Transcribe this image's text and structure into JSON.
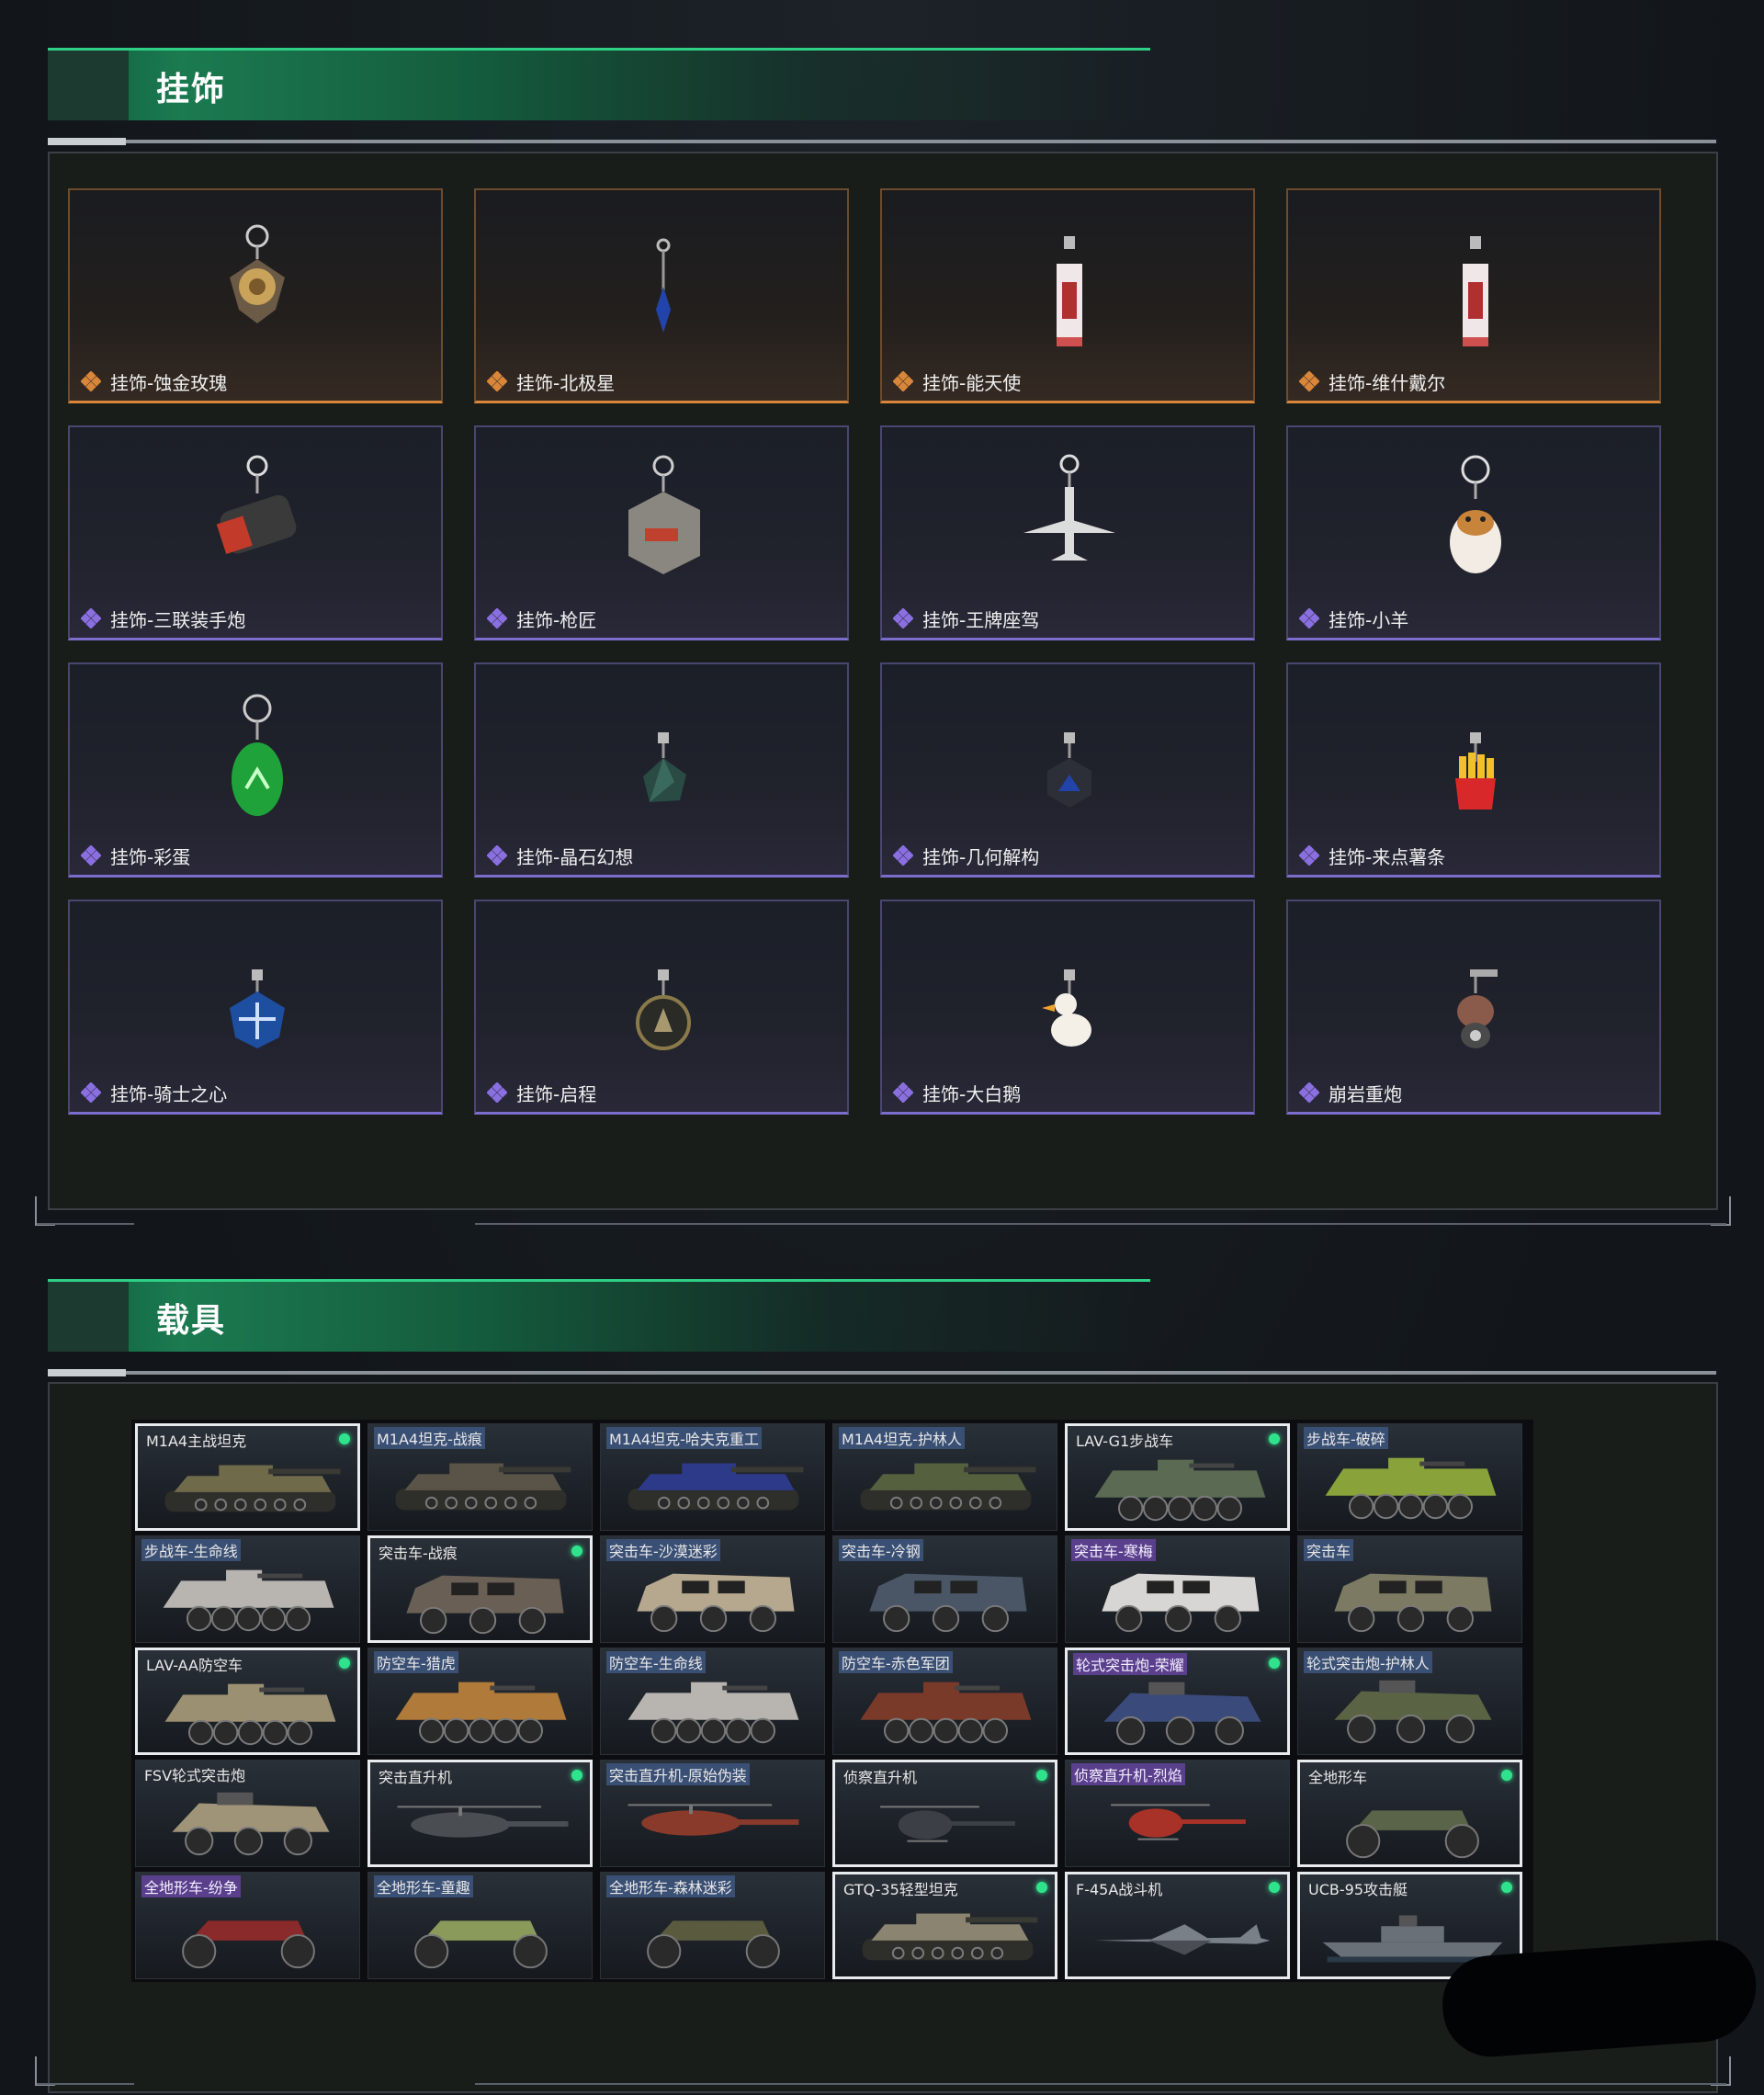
{
  "sections": {
    "charms": {
      "title": "挂饰",
      "items": [
        {
          "label": "挂饰-蚀金玫瑰",
          "rarity": "gold",
          "icon": "rose-charm-icon"
        },
        {
          "label": "挂饰-北极星",
          "rarity": "gold",
          "icon": "star-charm-icon"
        },
        {
          "label": "挂饰-能天使",
          "rarity": "gold",
          "icon": "tag-charm-icon"
        },
        {
          "label": "挂饰-维什戴尔",
          "rarity": "gold",
          "icon": "tag-charm-icon"
        },
        {
          "label": "挂饰-三联装手炮",
          "rarity": "purple",
          "icon": "cannon-charm-icon"
        },
        {
          "label": "挂饰-枪匠",
          "rarity": "purple",
          "icon": "box-charm-icon"
        },
        {
          "label": "挂饰-王牌座驾",
          "rarity": "purple",
          "icon": "plane-charm-icon"
        },
        {
          "label": "挂饰-小羊",
          "rarity": "purple",
          "icon": "sheep-charm-icon"
        },
        {
          "label": "挂饰-彩蛋",
          "rarity": "purple",
          "icon": "egg-charm-icon"
        },
        {
          "label": "挂饰-晶石幻想",
          "rarity": "purple",
          "icon": "crystal-charm-icon"
        },
        {
          "label": "挂饰-几何解构",
          "rarity": "purple",
          "icon": "geometry-charm-icon"
        },
        {
          "label": "挂饰-来点薯条",
          "rarity": "purple",
          "icon": "fries-charm-icon"
        },
        {
          "label": "挂饰-骑士之心",
          "rarity": "purple",
          "icon": "shield-charm-icon"
        },
        {
          "label": "挂饰-启程",
          "rarity": "purple",
          "icon": "medal-charm-icon"
        },
        {
          "label": "挂饰-大白鹅",
          "rarity": "purple",
          "icon": "goose-charm-icon"
        },
        {
          "label": "崩岩重炮",
          "rarity": "purple",
          "icon": "figure-charm-icon"
        }
      ]
    },
    "vehicles": {
      "title": "载具",
      "items": [
        {
          "label": "M1A4主战坦克",
          "selected": true,
          "badge": "none",
          "owned": true,
          "kind": "tank",
          "color": "#6f6a4a"
        },
        {
          "label": "M1A4坦克-战痕",
          "selected": false,
          "badge": "blu",
          "owned": false,
          "kind": "tank",
          "color": "#5a5448"
        },
        {
          "label": "M1A4坦克-哈夫克重工",
          "selected": false,
          "badge": "blu",
          "owned": false,
          "kind": "tank",
          "color": "#2d3a8a"
        },
        {
          "label": "M1A4坦克-护林人",
          "selected": false,
          "badge": "blu",
          "owned": false,
          "kind": "tank",
          "color": "#55603f"
        },
        {
          "label": "LAV-G1步战车",
          "selected": true,
          "badge": "none",
          "owned": true,
          "kind": "apc",
          "color": "#5b6a52"
        },
        {
          "label": "步战车-破碎",
          "selected": false,
          "badge": "blu",
          "owned": false,
          "kind": "apc",
          "color": "#8aa23a"
        },
        {
          "label": "步战车-生命线",
          "selected": false,
          "badge": "blu",
          "owned": false,
          "kind": "apc",
          "color": "#b8b4b0"
        },
        {
          "label": "突击车-战痕",
          "selected": true,
          "badge": "none",
          "owned": true,
          "kind": "truck",
          "color": "#6a5f55"
        },
        {
          "label": "突击车-沙漠迷彩",
          "selected": false,
          "badge": "blu",
          "owned": false,
          "kind": "truck",
          "color": "#b5a88e"
        },
        {
          "label": "突击车-冷钢",
          "selected": false,
          "badge": "blu",
          "owned": false,
          "kind": "truck",
          "color": "#4a5666"
        },
        {
          "label": "突击车-寒梅",
          "selected": false,
          "badge": "pur",
          "owned": false,
          "kind": "truck",
          "color": "#d8d6d4"
        },
        {
          "label": "突击车",
          "selected": false,
          "badge": "blu",
          "owned": false,
          "kind": "truck",
          "color": "#7c7a62"
        },
        {
          "label": "LAV-AA防空车",
          "selected": true,
          "badge": "none",
          "owned": true,
          "kind": "apc",
          "color": "#9c9072"
        },
        {
          "label": "防空车-猎虎",
          "selected": false,
          "badge": "blu",
          "owned": false,
          "kind": "apc",
          "color": "#b07a3a"
        },
        {
          "label": "防空车-生命线",
          "selected": false,
          "badge": "blu",
          "owned": false,
          "kind": "apc",
          "color": "#b8b4b0"
        },
        {
          "label": "防空车-赤色军团",
          "selected": false,
          "badge": "blu",
          "owned": false,
          "kind": "apc",
          "color": "#7a3a2a"
        },
        {
          "label": "轮式突击炮-荣耀",
          "selected": true,
          "badge": "pur",
          "owned": true,
          "kind": "buggy",
          "color": "#3a4a7a"
        },
        {
          "label": "轮式突击炮-护林人",
          "selected": false,
          "badge": "blu",
          "owned": false,
          "kind": "buggy",
          "color": "#5a6444"
        },
        {
          "label": "FSV轮式突击炮",
          "selected": false,
          "badge": "none",
          "owned": false,
          "kind": "buggy",
          "color": "#a09478"
        },
        {
          "label": "突击直升机",
          "selected": true,
          "badge": "none",
          "owned": true,
          "kind": "heli",
          "color": "#4a4e52"
        },
        {
          "label": "突击直升机-原始伪装",
          "selected": false,
          "badge": "blu",
          "owned": false,
          "kind": "heli",
          "color": "#8a3a2a"
        },
        {
          "label": "侦察直升机",
          "selected": true,
          "badge": "none",
          "owned": true,
          "kind": "lheli",
          "color": "#3c4046"
        },
        {
          "label": "侦察直升机-烈焰",
          "selected": false,
          "badge": "pur",
          "owned": false,
          "kind": "lheli",
          "color": "#a83228"
        },
        {
          "label": "全地形车",
          "selected": true,
          "badge": "none",
          "owned": true,
          "kind": "atv",
          "color": "#5a6448"
        },
        {
          "label": "全地形车-纷争",
          "selected": false,
          "badge": "pur",
          "owned": false,
          "kind": "atv",
          "color": "#8a2a2a"
        },
        {
          "label": "全地形车-童趣",
          "selected": false,
          "badge": "blu",
          "owned": false,
          "kind": "atv",
          "color": "#8a9a5a"
        },
        {
          "label": "全地形车-森林迷彩",
          "selected": false,
          "badge": "blu",
          "owned": false,
          "kind": "atv",
          "color": "#5a5a3e"
        },
        {
          "label": "GTQ-35轻型坦克",
          "selected": true,
          "badge": "none",
          "owned": true,
          "kind": "tank",
          "color": "#8a8470"
        },
        {
          "label": "F-45A战斗机",
          "selected": true,
          "badge": "none",
          "owned": true,
          "kind": "jet",
          "color": "#7a8088"
        },
        {
          "label": "UCB-95攻击艇",
          "selected": true,
          "badge": "none",
          "owned": true,
          "kind": "boat",
          "color": "#6a7078"
        }
      ]
    }
  },
  "colors": {
    "accent_green": "#2fcf86",
    "gold_rarity": "#d8863a",
    "purple_rarity": "#8a6fe0",
    "owned_dot": "#2fe38c"
  }
}
